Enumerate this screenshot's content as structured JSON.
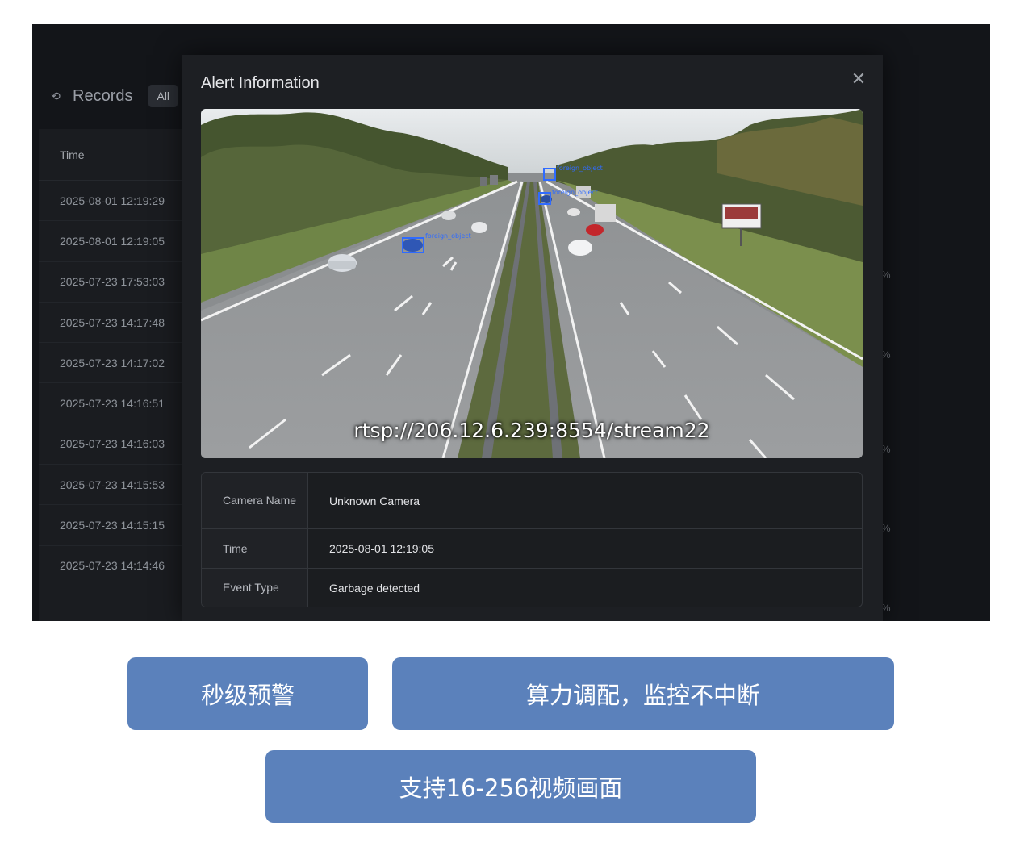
{
  "records": {
    "title": "Records",
    "filter_label": "All",
    "column_time": "Time",
    "rows": [
      "2025-08-01 12:19:29",
      "2025-08-01 12:19:05",
      "2025-07-23 17:53:03",
      "2025-07-23 14:17:48",
      "2025-07-23 14:17:02",
      "2025-07-23 14:16:51",
      "2025-07-23 14:16:03",
      "2025-07-23 14:15:53",
      "2025-07-23 14:15:15",
      "2025-07-23 14:14:46"
    ]
  },
  "right_strip": [
    "%",
    "%",
    "%",
    "%",
    "%"
  ],
  "modal": {
    "title": "Alert Information",
    "stream_url": "rtsp://206.12.6.239:8554/stream22",
    "detections": [
      "foreign_object",
      "foreign_object",
      "foreign_object"
    ],
    "info": [
      {
        "key": "Camera Name",
        "value": "Unknown Camera"
      },
      {
        "key": "Time",
        "value": "2025-08-01 12:19:05"
      },
      {
        "key": "Event Type",
        "value": "Garbage detected"
      }
    ]
  },
  "features": {
    "f1": "秒级预警",
    "f2": "算力调配，监控不中断",
    "f3": "支持16-256视频画面"
  },
  "colors": {
    "feature_bg": "#5b81bb",
    "app_bg": "#131519",
    "modal_bg": "#1d1f23",
    "detection_box": "#2f6bff"
  }
}
